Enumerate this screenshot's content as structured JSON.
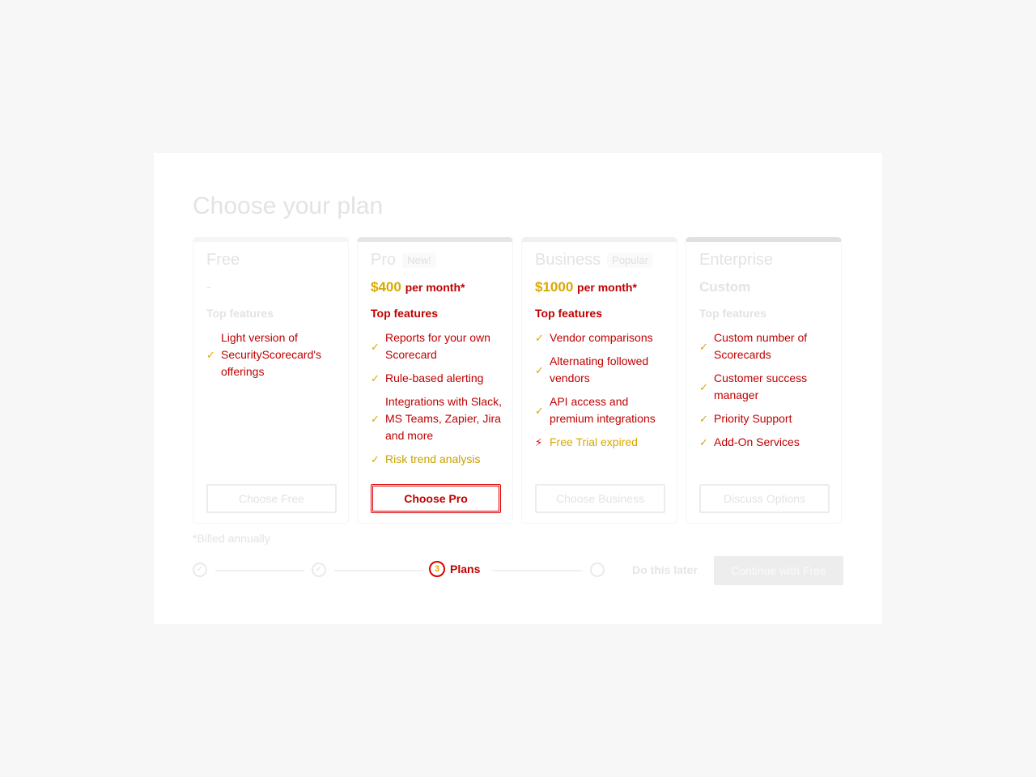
{
  "modal": {
    "title": "Choose your plan",
    "billed_note": "*Billed annually"
  },
  "plans": [
    {
      "name": "Free",
      "badge": "",
      "price": "-",
      "price_per": "",
      "features_heading": "Top features",
      "features": [
        {
          "icon": "check",
          "text": "Light version of SecurityScorecard's offerings"
        }
      ],
      "button": "Choose Free"
    },
    {
      "name": "Pro",
      "badge": "New!",
      "price": "$400",
      "price_per": "per month*",
      "features_heading": "Top features",
      "features": [
        {
          "icon": "check",
          "text": "Reports for your own Scorecard"
        },
        {
          "icon": "check",
          "text": "Rule-based alerting"
        },
        {
          "icon": "check",
          "text": "Integrations with Slack, MS Teams, Zapier, Jira and more"
        },
        {
          "icon": "check",
          "text": "Risk trend analysis"
        }
      ],
      "button": "Choose Pro"
    },
    {
      "name": "Business",
      "badge": "Popular",
      "price": "$1000",
      "price_per": "per month*",
      "features_heading": "Top features",
      "features": [
        {
          "icon": "check",
          "text": "Vendor comparisons"
        },
        {
          "icon": "check",
          "text": "Alternating followed vendors"
        },
        {
          "icon": "check",
          "text": "API access and premium integrations"
        },
        {
          "icon": "bolt",
          "text": "Free Trial expired"
        }
      ],
      "button": "Choose Business"
    },
    {
      "name": "Enterprise",
      "badge": "",
      "price": "Custom",
      "price_per": "",
      "features_heading": "Top features",
      "features": [
        {
          "icon": "check",
          "text": "Custom number of Scorecards"
        },
        {
          "icon": "check",
          "text": "Customer success manager"
        },
        {
          "icon": "check",
          "text": "Priority Support"
        },
        {
          "icon": "check",
          "text": "Add-On Services"
        }
      ],
      "button": "Discuss Options"
    }
  ],
  "stepper": {
    "current_number": "3",
    "current_label": "Plans"
  },
  "actions": {
    "later": "Do this later",
    "continue": "Continue with Free"
  }
}
